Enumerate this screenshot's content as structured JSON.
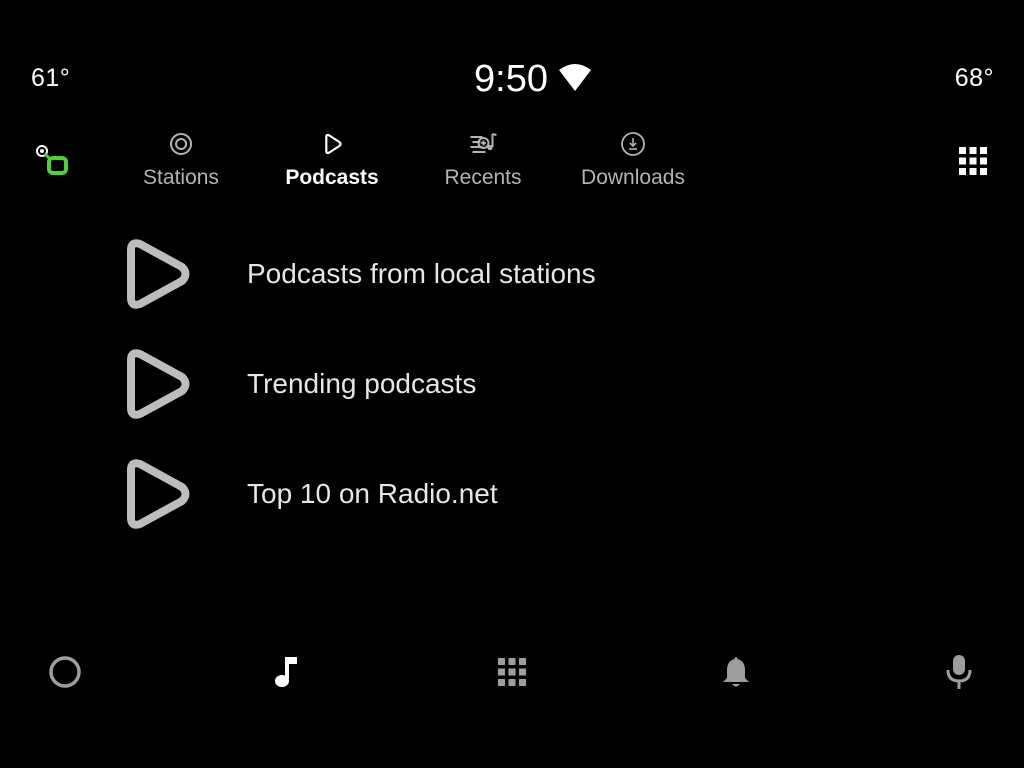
{
  "status_bar": {
    "temp_left": "61°",
    "time": "9:50",
    "temp_right": "68°"
  },
  "tabs": [
    {
      "label": "Stations",
      "icon": "radio-target-icon",
      "active": false
    },
    {
      "label": "Podcasts",
      "icon": "podcast-play-icon",
      "active": true
    },
    {
      "label": "Recents",
      "icon": "recents-list-icon",
      "active": false
    },
    {
      "label": "Downloads",
      "icon": "download-circle-icon",
      "active": false
    }
  ],
  "list": [
    {
      "label": "Podcasts from local stations",
      "icon": "podcast-play-icon"
    },
    {
      "label": "Trending podcasts",
      "icon": "podcast-play-icon"
    },
    {
      "label": "Top 10 on Radio.net",
      "icon": "podcast-play-icon"
    }
  ],
  "bottom_nav": [
    {
      "icon": "home-circle-icon"
    },
    {
      "icon": "music-note-icon",
      "active": true
    },
    {
      "icon": "app-grid-icon"
    },
    {
      "icon": "bell-icon"
    },
    {
      "icon": "microphone-icon"
    }
  ],
  "colors": {
    "background": "#000000",
    "text_active": "#ffffff",
    "text_inactive": "#b3b3b3",
    "icon_gray": "#bdbdbd",
    "logo_green": "#4cd137"
  }
}
